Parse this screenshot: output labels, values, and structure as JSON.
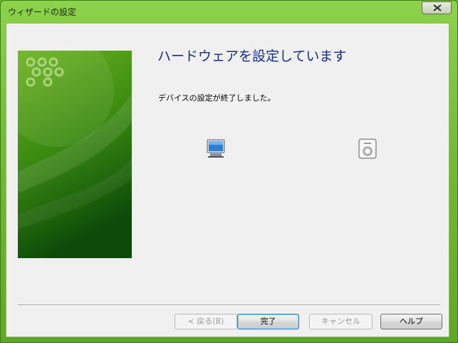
{
  "window": {
    "title": "ウィザードの設定"
  },
  "wizard": {
    "heading": "ハードウェアを設定しています",
    "message": "デバイスの設定が終了しました。",
    "icons": [
      "computer-icon",
      "device-icon"
    ]
  },
  "buttons": {
    "back": "< 戻る(B)",
    "finish": "完了",
    "cancel": "キャンセル",
    "help": "ヘルプ"
  },
  "colors": {
    "frame": "#74bd35",
    "heading": "#142e8c",
    "banner_dark": "#0b4a08",
    "banner_light": "#6cb21e"
  }
}
